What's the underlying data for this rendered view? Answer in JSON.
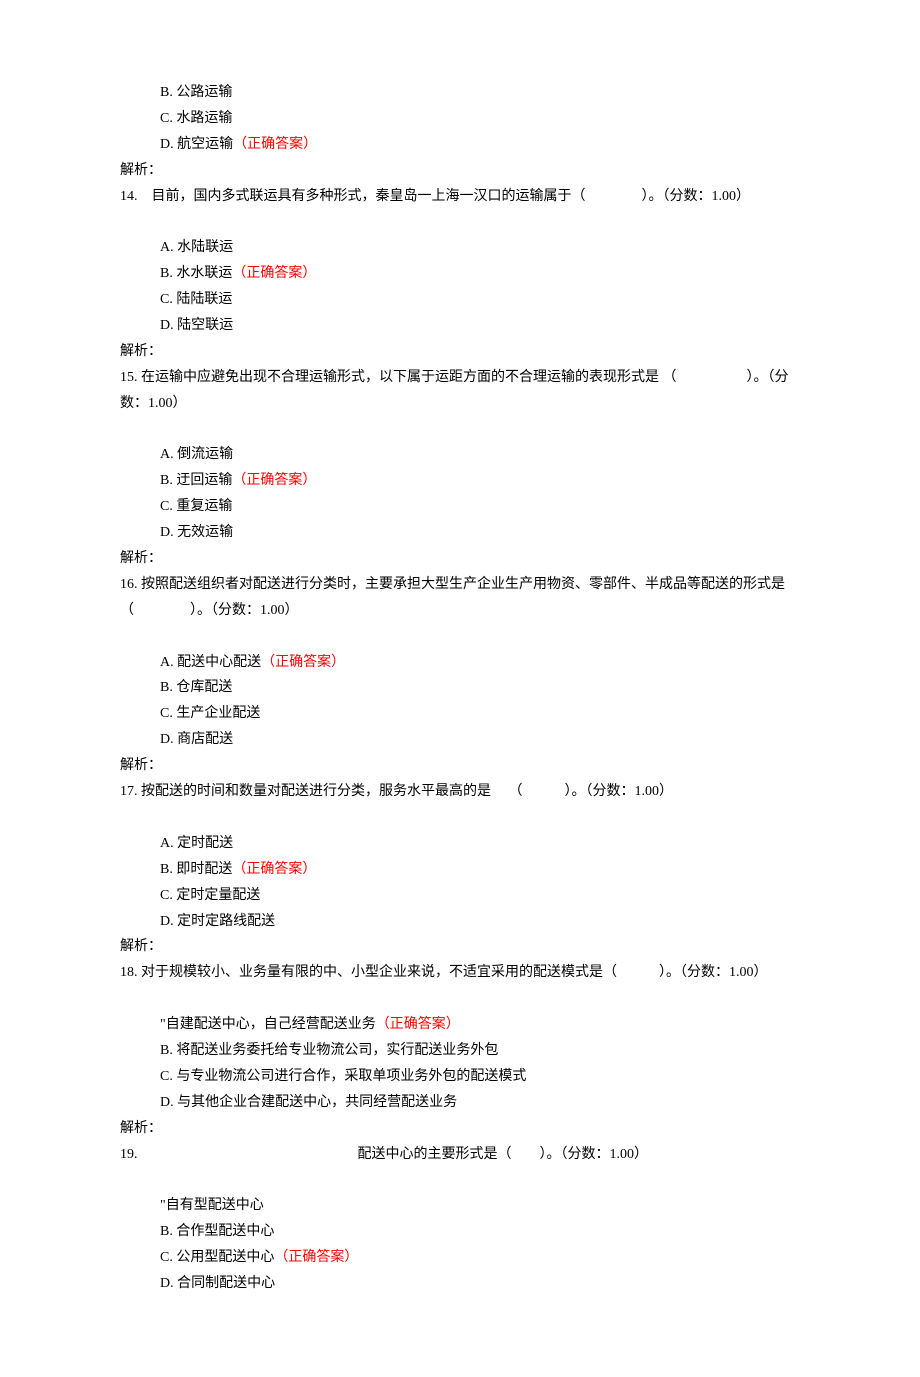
{
  "correct_label": "（正确答案）",
  "analysis_label": "解析：",
  "q13_partial": {
    "options": [
      {
        "label": "B.",
        "text": "公路运输",
        "correct": false
      },
      {
        "label": "C.",
        "text": "水路运输",
        "correct": false
      },
      {
        "label": "D.",
        "text": "航空运输",
        "correct": true
      }
    ]
  },
  "q14": {
    "stem": "14.　目前，国内多式联运具有多种形式，秦皇岛一上海一汉口的运输属于（　　　　）。（分数：1.00）",
    "options": [
      {
        "label": "A.",
        "text": "水陆联运",
        "correct": false
      },
      {
        "label": "B.",
        "text": "水水联运",
        "correct": true
      },
      {
        "label": "C.",
        "text": "陆陆联运",
        "correct": false
      },
      {
        "label": "D.",
        "text": "陆空联运",
        "correct": false
      }
    ]
  },
  "q15": {
    "stem": "15. 在运输中应避免出现不合理运输形式，以下属于运距方面的不合理运输的表现形式是 （　　　　　）。（分数：1.00）",
    "options": [
      {
        "label": "A.",
        "text": "倒流运输",
        "correct": false
      },
      {
        "label": "B.",
        "text": "迂回运输",
        "correct": true
      },
      {
        "label": "C.",
        "text": "重复运输",
        "correct": false
      },
      {
        "label": "D.",
        "text": "无效运输",
        "correct": false
      }
    ]
  },
  "q16": {
    "stem": "16. 按照配送组织者对配送进行分类时，主要承担大型生产企业生产用物资、零部件、半成品等配送的形式是（　　　　）。（分数：1.00）",
    "options": [
      {
        "label": "A.",
        "text": "配送中心配送",
        "correct": true
      },
      {
        "label": "B.",
        "text": "仓库配送",
        "correct": false
      },
      {
        "label": "C.",
        "text": "生产企业配送",
        "correct": false
      },
      {
        "label": "D.",
        "text": "商店配送",
        "correct": false
      }
    ]
  },
  "q17": {
    "stem": "17. 按配送的时间和数量对配送进行分类，服务水平最高的是　 （　　　）。（分数：1.00）",
    "options": [
      {
        "label": "A.",
        "text": "定时配送",
        "correct": false
      },
      {
        "label": "B.",
        "text": "即时配送",
        "correct": true
      },
      {
        "label": "C.",
        "text": "定时定量配送",
        "correct": false
      },
      {
        "label": "D.",
        "text": "定时定路线配送",
        "correct": false
      }
    ]
  },
  "q18": {
    "stem": "18. 对于规模较小、业务量有限的中、小型企业来说，不适宜采用的配送模式是（　　　）。（分数：1.00）",
    "options": [
      {
        "label": "\"自建配送中心，自己经营配送业务",
        "text": "",
        "correct": true,
        "nospace": true
      },
      {
        "label": "B.",
        "text": "将配送业务委托给专业物流公司，实行配送业务外包",
        "correct": false
      },
      {
        "label": "C.",
        "text": "与专业物流公司进行合作，采取单项业务外包的配送模式",
        "correct": false
      },
      {
        "label": "D.",
        "text": "与其他企业合建配送中心，共同经营配送业务",
        "correct": false
      }
    ]
  },
  "q19": {
    "stem_prefix": "19.",
    "stem_suffix": "配送中心的主要形式是（　　）。（分数：1.00）",
    "options": [
      {
        "label": "\"自有型配送中心",
        "text": "",
        "correct": false,
        "nospace": true
      },
      {
        "label": "B.",
        "text": "合作型配送中心",
        "correct": false
      },
      {
        "label": "C.",
        "text": "公用型配送中心",
        "correct": true
      },
      {
        "label": "D.",
        "text": "合同制配送中心",
        "correct": false
      }
    ]
  }
}
